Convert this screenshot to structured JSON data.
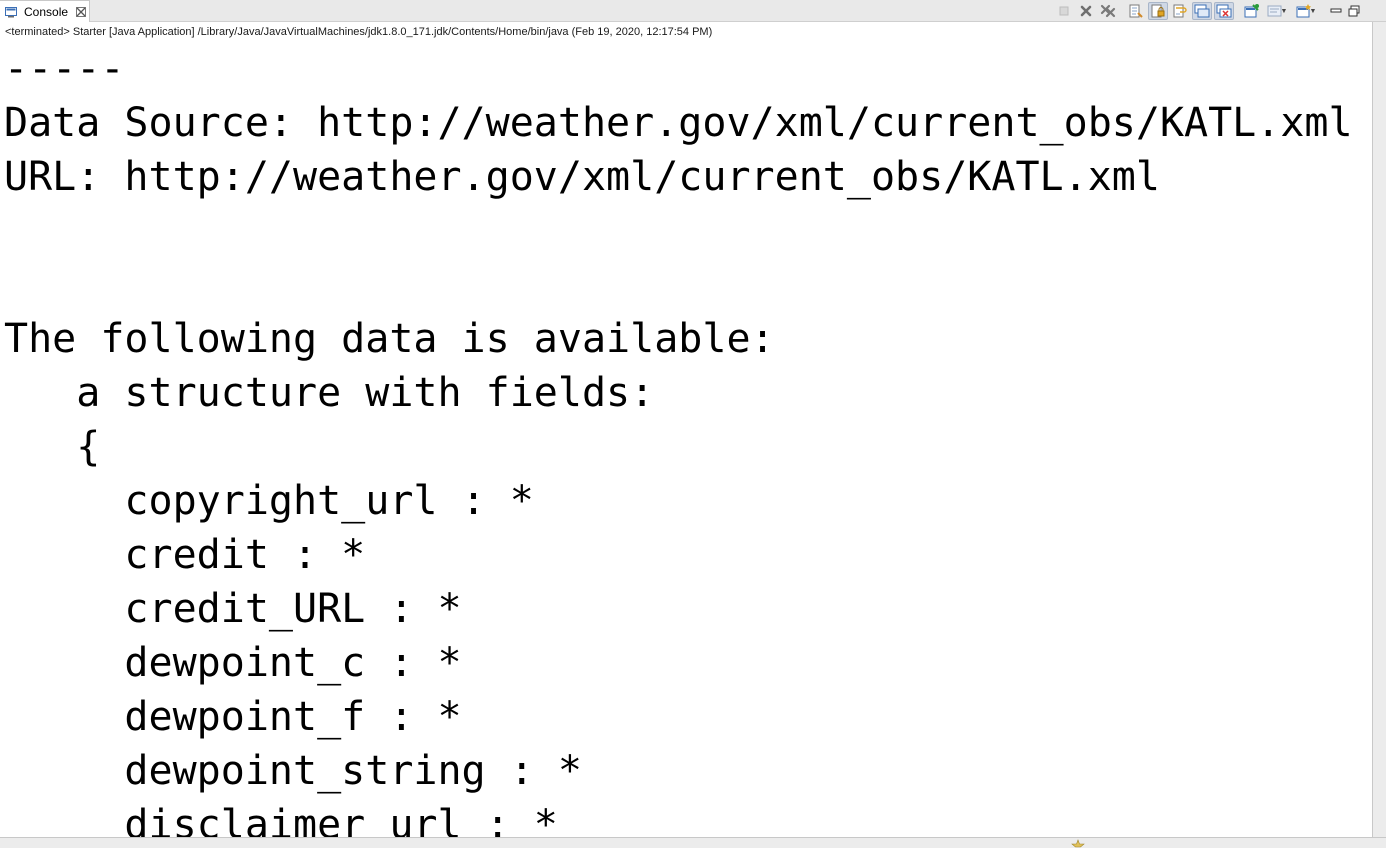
{
  "tab": {
    "label": "Console",
    "icon": "console-icon",
    "close_icon": "close-icon"
  },
  "toolbar": {
    "buttons": [
      {
        "name": "terminate-button",
        "icon": "stop-square-icon"
      },
      {
        "name": "remove-launch-button",
        "icon": "x-icon"
      },
      {
        "name": "remove-all-terminated-button",
        "icon": "double-x-icon"
      },
      {
        "name": "clear-console-button",
        "icon": "clear-console-icon"
      },
      {
        "name": "scroll-lock-button",
        "icon": "lock-icon"
      },
      {
        "name": "word-wrap-button",
        "icon": "word-wrap-icon"
      },
      {
        "name": "show-on-stdout-button",
        "icon": "stdout-icon"
      },
      {
        "name": "show-on-stderr-button",
        "icon": "stderr-icon"
      },
      {
        "name": "pin-console-button",
        "icon": "pin-icon"
      },
      {
        "name": "display-console-button",
        "icon": "display-console-icon"
      },
      {
        "name": "open-console-button",
        "icon": "new-console-icon"
      },
      {
        "name": "minimize-button",
        "icon": "minimize-icon"
      },
      {
        "name": "maximize-button",
        "icon": "maximize-icon"
      }
    ]
  },
  "status": {
    "text": "<terminated> Starter [Java Application] /Library/Java/JavaVirtualMachines/jdk1.8.0_171.jdk/Contents/Home/bin/java (Feb 19, 2020, 12:17:54 PM)"
  },
  "console": {
    "lines": [
      "-----",
      "Data Source: http://weather.gov/xml/current_obs/KATL.xml",
      "URL: http://weather.gov/xml/current_obs/KATL.xml",
      "",
      "",
      "The following data is available:",
      "   a structure with fields:",
      "   {",
      "     copyright_url : *",
      "     credit : *",
      "     credit_URL : *",
      "     dewpoint_c : *",
      "     dewpoint_f : *",
      "     dewpoint_string : *",
      "     disclaimer_url : *"
    ]
  },
  "colors": {
    "background": "#ffffff",
    "text": "#000000",
    "chrome": "#ececec",
    "accent": "#3b6fb6"
  }
}
